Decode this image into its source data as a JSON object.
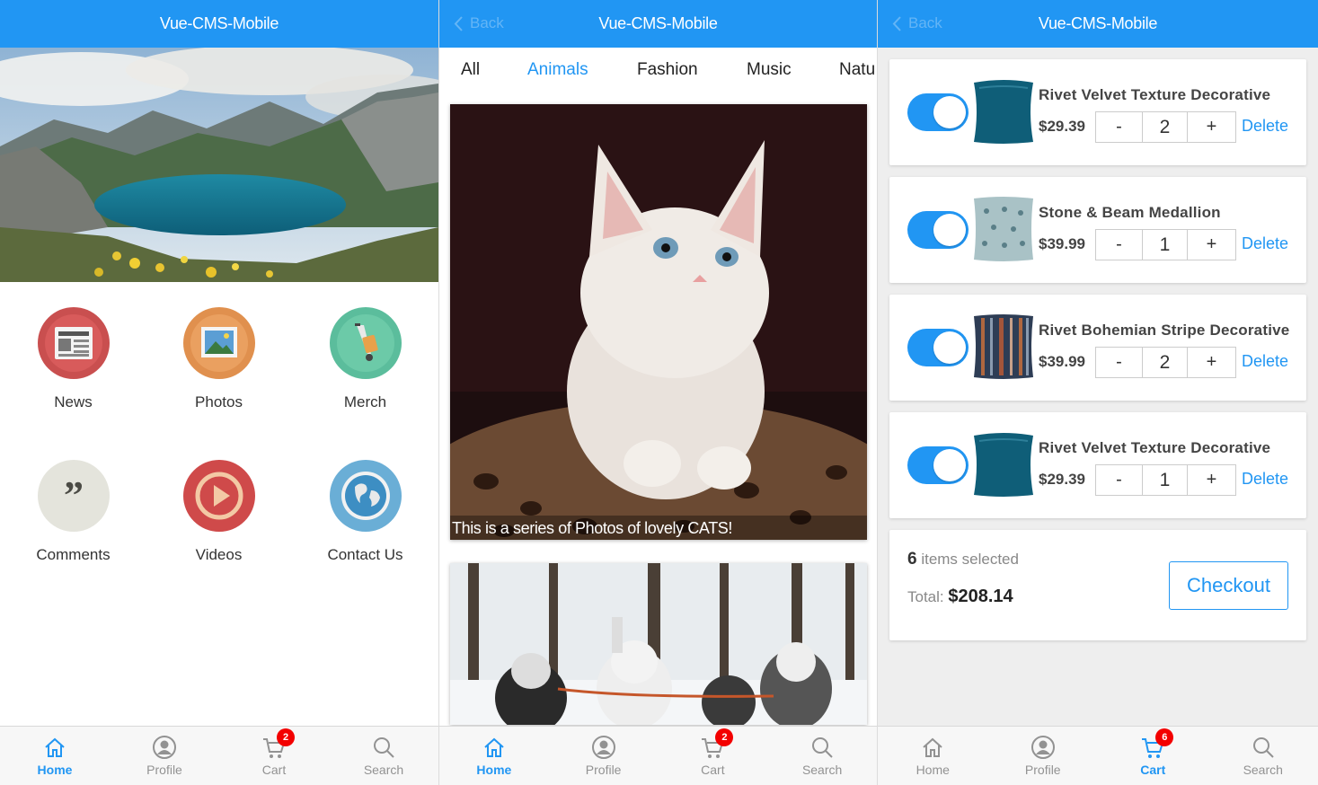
{
  "app_title": "Vue-CMS-Mobile",
  "back_label": "Back",
  "colors": {
    "primary": "#2196f3",
    "badge": "#f30000",
    "tab_inactive": "#929292"
  },
  "home": {
    "grid": [
      {
        "label": "News",
        "icon": "news-icon"
      },
      {
        "label": "Photos",
        "icon": "photos-icon"
      },
      {
        "label": "Merch",
        "icon": "merch-icon"
      },
      {
        "label": "Comments",
        "icon": "comments-icon"
      },
      {
        "label": "Videos",
        "icon": "videos-icon"
      },
      {
        "label": "Contact Us",
        "icon": "contact-icon"
      }
    ]
  },
  "photos": {
    "categories": [
      "All",
      "Animals",
      "Fashion",
      "Music",
      "Natu"
    ],
    "active_category": "Animals",
    "items": [
      {
        "caption": "This is a series of Photos of lovely CATS!"
      }
    ]
  },
  "cart": {
    "items": [
      {
        "name": "Rivet Velvet Texture Decorative",
        "price": "$29.39",
        "qty": "2",
        "selected": true,
        "pillow": "velvet"
      },
      {
        "name": "Stone & Beam Medallion",
        "price": "$39.99",
        "qty": "1",
        "selected": true,
        "pillow": "medallion"
      },
      {
        "name": "Rivet Bohemian Stripe Decorative",
        "price": "$39.99",
        "qty": "2",
        "selected": true,
        "pillow": "stripe"
      },
      {
        "name": "Rivet Velvet Texture Decorative",
        "price": "$29.39",
        "qty": "1",
        "selected": true,
        "pillow": "velvet"
      }
    ],
    "minus_label": "-",
    "plus_label": "+",
    "delete_label": "Delete",
    "selected_count": "6",
    "selected_text": "items selected",
    "total_label": "Total:",
    "total_value": "$208.14",
    "checkout_label": "Checkout"
  },
  "tabbar": {
    "tabs": [
      {
        "label": "Home",
        "icon": "home-icon"
      },
      {
        "label": "Profile",
        "icon": "profile-icon"
      },
      {
        "label": "Cart",
        "icon": "cart-icon"
      },
      {
        "label": "Search",
        "icon": "search-icon"
      }
    ],
    "cart_badges": [
      "2",
      "2",
      "6"
    ],
    "active_tabs": [
      "Home",
      "Home",
      "Cart"
    ]
  }
}
